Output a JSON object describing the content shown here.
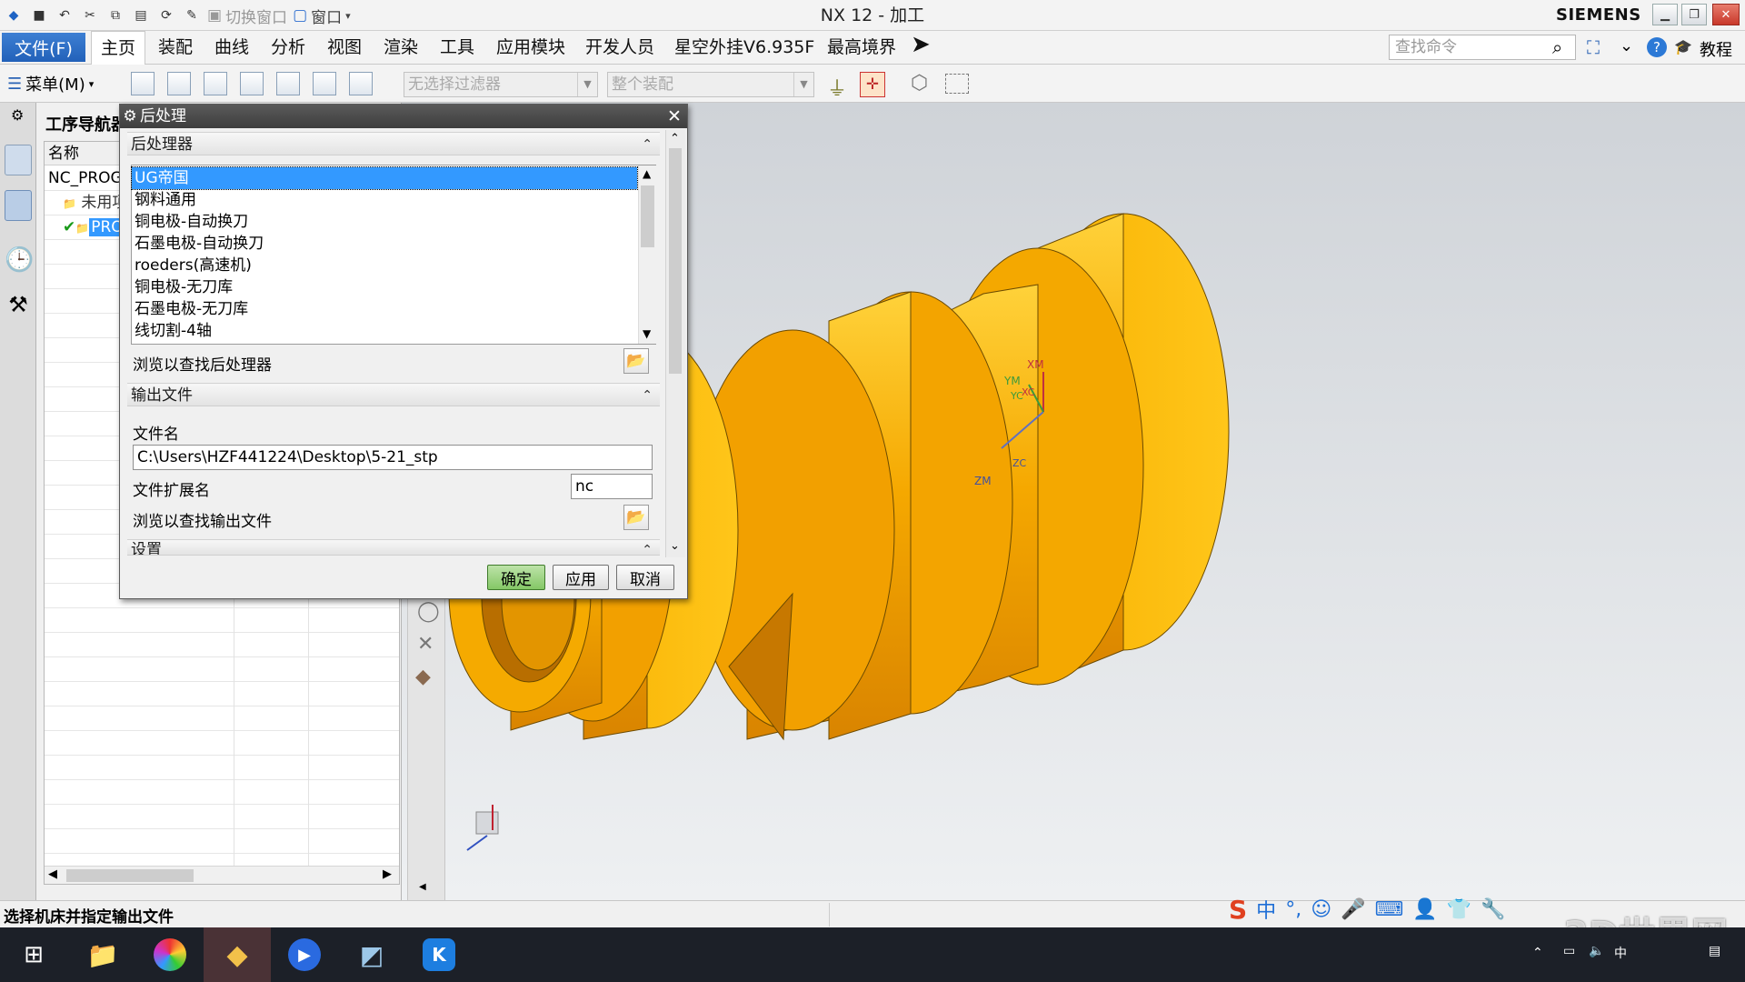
{
  "window": {
    "title": "NX 12 - 加工",
    "brand": "SIEMENS",
    "qat_switch_window": "切换窗口",
    "qat_window": "窗口"
  },
  "menubar": {
    "file": "文件(F)",
    "tabs": [
      "主页",
      "装配",
      "曲线",
      "分析",
      "视图",
      "渲染",
      "工具",
      "应用模块",
      "开发人员",
      "星空外挂V6.935F",
      "最高境界"
    ],
    "search_placeholder": "查找命令",
    "tutorial": "教程"
  },
  "toolbar": {
    "menu_label": "菜单(M)",
    "filter_combo": "无选择过滤器",
    "assembly_combo": "整个装配"
  },
  "navigator": {
    "title": "工序导航器",
    "column_name": "名称",
    "rows": [
      "NC_PROGRAM",
      "未用项",
      "PROGRAM"
    ]
  },
  "dialog": {
    "title": "后处理",
    "group_postprocessor": "后处理器",
    "postprocessors": [
      "UG帝国",
      "钢料通用",
      "铜电极-自动换刀",
      "石墨电极-自动换刀",
      "roeders(高速机)",
      "铜电极-无刀库",
      "石墨电极-无刀库",
      "线切割-4轴"
    ],
    "selected_index": 0,
    "browse_post": "浏览以查找后处理器",
    "group_output": "输出文件",
    "filename_label": "文件名",
    "filename_value": "C:\\Users\\HZF441224\\Desktop\\5-21_stp",
    "ext_label": "文件扩展名",
    "ext_value": "nc",
    "browse_output": "浏览以查找输出文件",
    "group_settings": "设置",
    "ok": "确定",
    "apply": "应用",
    "cancel": "取消"
  },
  "csys_labels": {
    "xm": "XM",
    "ym": "YM",
    "zm": "ZM",
    "xc": "XC",
    "yc": "YC",
    "zc": "ZC"
  },
  "status": {
    "text": "选择机床并指定输出文件"
  },
  "ime": {
    "lang": "中"
  },
  "watermark": "3D世界网"
}
